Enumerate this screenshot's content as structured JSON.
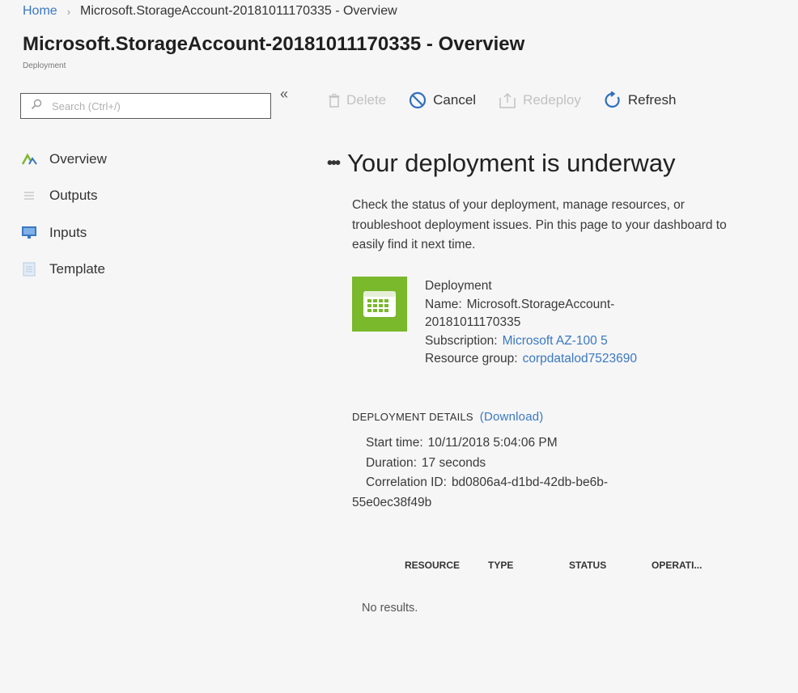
{
  "breadcrumb": {
    "home": "Home",
    "separator": "›",
    "current": "Microsoft.StorageAccount-20181011170335 - Overview"
  },
  "page": {
    "title": "Microsoft.StorageAccount-20181011170335 - Overview",
    "subtitle": "Deployment"
  },
  "search": {
    "placeholder": "Search (Ctrl+/)",
    "collapse_glyph": "«"
  },
  "sidebar": {
    "items": [
      {
        "label": "Overview",
        "icon": "overview-icon"
      },
      {
        "label": "Outputs",
        "icon": "outputs-icon"
      },
      {
        "label": "Inputs",
        "icon": "inputs-icon"
      },
      {
        "label": "Template",
        "icon": "template-icon"
      }
    ]
  },
  "toolbar": {
    "delete": "Delete",
    "cancel": "Cancel",
    "redeploy": "Redeploy",
    "refresh": "Refresh"
  },
  "status": {
    "dots": "•••",
    "heading": "Your deployment is underway",
    "description": "Check the status of your deployment, manage resources, or troubleshoot deployment issues. Pin this page to your dashboard to easily find it next time."
  },
  "deployment": {
    "label": "Deployment",
    "name_label": "Name:",
    "name_value_1": "Microsoft.StorageAccount-",
    "name_value_2": "20181011170335",
    "subscription_label": "Subscription:",
    "subscription_value": "Microsoft AZ-100 5",
    "resource_group_label": "Resource group:",
    "resource_group_value": "corpdatalod7523690"
  },
  "details": {
    "heading": "DEPLOYMENT DETAILS",
    "download": "(Download)",
    "start_label": "Start time:",
    "start_value": "10/11/2018 5:04:06 PM",
    "duration_label": "Duration:",
    "duration_value": "17 seconds",
    "correlation_label": "Correlation ID:",
    "correlation_value_1": "bd0806a4-d1bd-42db-be6b-",
    "correlation_value_2": "55e0ec38f49b"
  },
  "table": {
    "columns": [
      "RESOURCE",
      "TYPE",
      "STATUS",
      "OPERATI..."
    ],
    "empty_text": "No results."
  },
  "colors": {
    "link": "#3a78c2",
    "deployment_tile": "#7ab82c",
    "disabled": "#c2c2c2"
  }
}
